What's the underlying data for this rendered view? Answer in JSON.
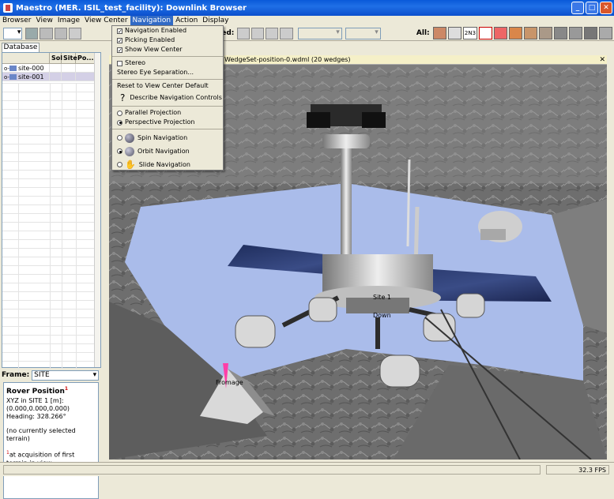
{
  "window": {
    "title": "Maestro (MER. ISIL_test_facility): Downlink Browser"
  },
  "menubar": {
    "items": [
      "Browser",
      "View",
      "Image",
      "View Center",
      "Navigation",
      "Action",
      "Display"
    ]
  },
  "toolbar": {
    "selected_label": "Selected:",
    "all_label": "All:",
    "all_combo_text": "2N3"
  },
  "navigation_menu": {
    "navigation_enabled": "Navigation Enabled",
    "picking_enabled": "Picking Enabled",
    "show_view_center": "Show View Center",
    "stereo": "Stereo",
    "stereo_eye_separation": "Stereo Eye Separation...",
    "reset_view_center": "Reset to View Center Default",
    "describe_controls": "Describe Navigation Controls",
    "parallel_projection": "Parallel Projection",
    "perspective_projection": "Perspective Projection",
    "spin_navigation": "Spin Navigation",
    "orbit_navigation": "Orbit Navigation",
    "slide_navigation": "Slide Navigation",
    "checked": {
      "navigation_enabled": true,
      "picking_enabled": true,
      "show_view_center": true,
      "stereo": false
    },
    "projection_selected": "perspective",
    "navigation_selected": "orbit"
  },
  "database": {
    "tab": "Database",
    "columns": [
      "",
      "Sol",
      "Site",
      "Po..."
    ],
    "rows": [
      {
        "name": "site-000"
      },
      {
        "name": "site-001"
      }
    ]
  },
  "frame": {
    "label": "Frame:",
    "value": "SITE"
  },
  "rover_position": {
    "title": "Rover Position",
    "title_mark": "1",
    "xyz_label": "XYZ in SITE 1 [m]:",
    "xyz_value": "(0.000,0.000,0.000)",
    "heading": "Heading: 328.266°",
    "no_selection": "(no currently selected terrain)",
    "footnote_mark": "1",
    "footnote": "at acquisition of first terrain in view"
  },
  "view": {
    "title": "WedgeSet-position-0.wdml (20 wedges)",
    "labels": {
      "site": "Site 1",
      "down": "Down",
      "fromage": "Fromage"
    }
  },
  "status": {
    "fps": "32.3 FPS"
  }
}
